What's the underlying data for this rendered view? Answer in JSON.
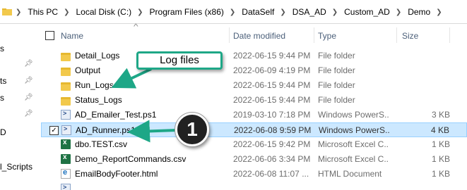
{
  "breadcrumb": [
    "This PC",
    "Local Disk (C:)",
    "Program Files (x86)",
    "DataSelf",
    "DSA_AD",
    "Custom_AD",
    "Demo"
  ],
  "navpane": {
    "items": [
      "s",
      "ts",
      "s",
      "D",
      "l_Scripts"
    ]
  },
  "columns": {
    "name": "Name",
    "date": "Date modified",
    "type": "Type",
    "size": "Size"
  },
  "files": [
    {
      "name": "Detail_Logs",
      "date": "2022-06-15 9:44 PM",
      "type": "File folder",
      "size": "",
      "icon": "folder-icon"
    },
    {
      "name": "Output",
      "date": "2022-06-09 4:19 PM",
      "type": "File folder",
      "size": "",
      "icon": "folder-icon"
    },
    {
      "name": "Run_Logs",
      "date": "2022-06-15 9:44 PM",
      "type": "File folder",
      "size": "",
      "icon": "folder-icon"
    },
    {
      "name": "Status_Logs",
      "date": "2022-06-15 9:44 PM",
      "type": "File folder",
      "size": "",
      "icon": "folder-icon"
    },
    {
      "name": "AD_Emailer_Test.ps1",
      "date": "2019-03-10 7:18 PM",
      "type": "Windows PowerS...",
      "size": "3 KB",
      "icon": "powershell-icon"
    },
    {
      "name": "AD_Runner.ps1",
      "date": "2022-06-08 9:59 PM",
      "type": "Windows PowerS...",
      "size": "4 KB",
      "icon": "powershell-icon",
      "selected": true
    },
    {
      "name": "dbo.TEST.csv",
      "date": "2022-06-15 9:42 PM",
      "type": "Microsoft Excel C...",
      "size": "1 KB",
      "icon": "excel-icon"
    },
    {
      "name": "Demo_ReportCommands.csv",
      "date": "2022-06-06 3:34 PM",
      "type": "Microsoft Excel C...",
      "size": "1 KB",
      "icon": "excel-icon"
    },
    {
      "name": "EmailBodyFooter.html",
      "date": "2022-06-08 11:07 ...",
      "type": "HTML Document",
      "size": "1 KB",
      "icon": "html-icon"
    }
  ],
  "annotations": {
    "log_callout": "Log files",
    "step_badge": "1"
  },
  "colors": {
    "accent": "#1ea787",
    "selection": "#cce8ff"
  }
}
